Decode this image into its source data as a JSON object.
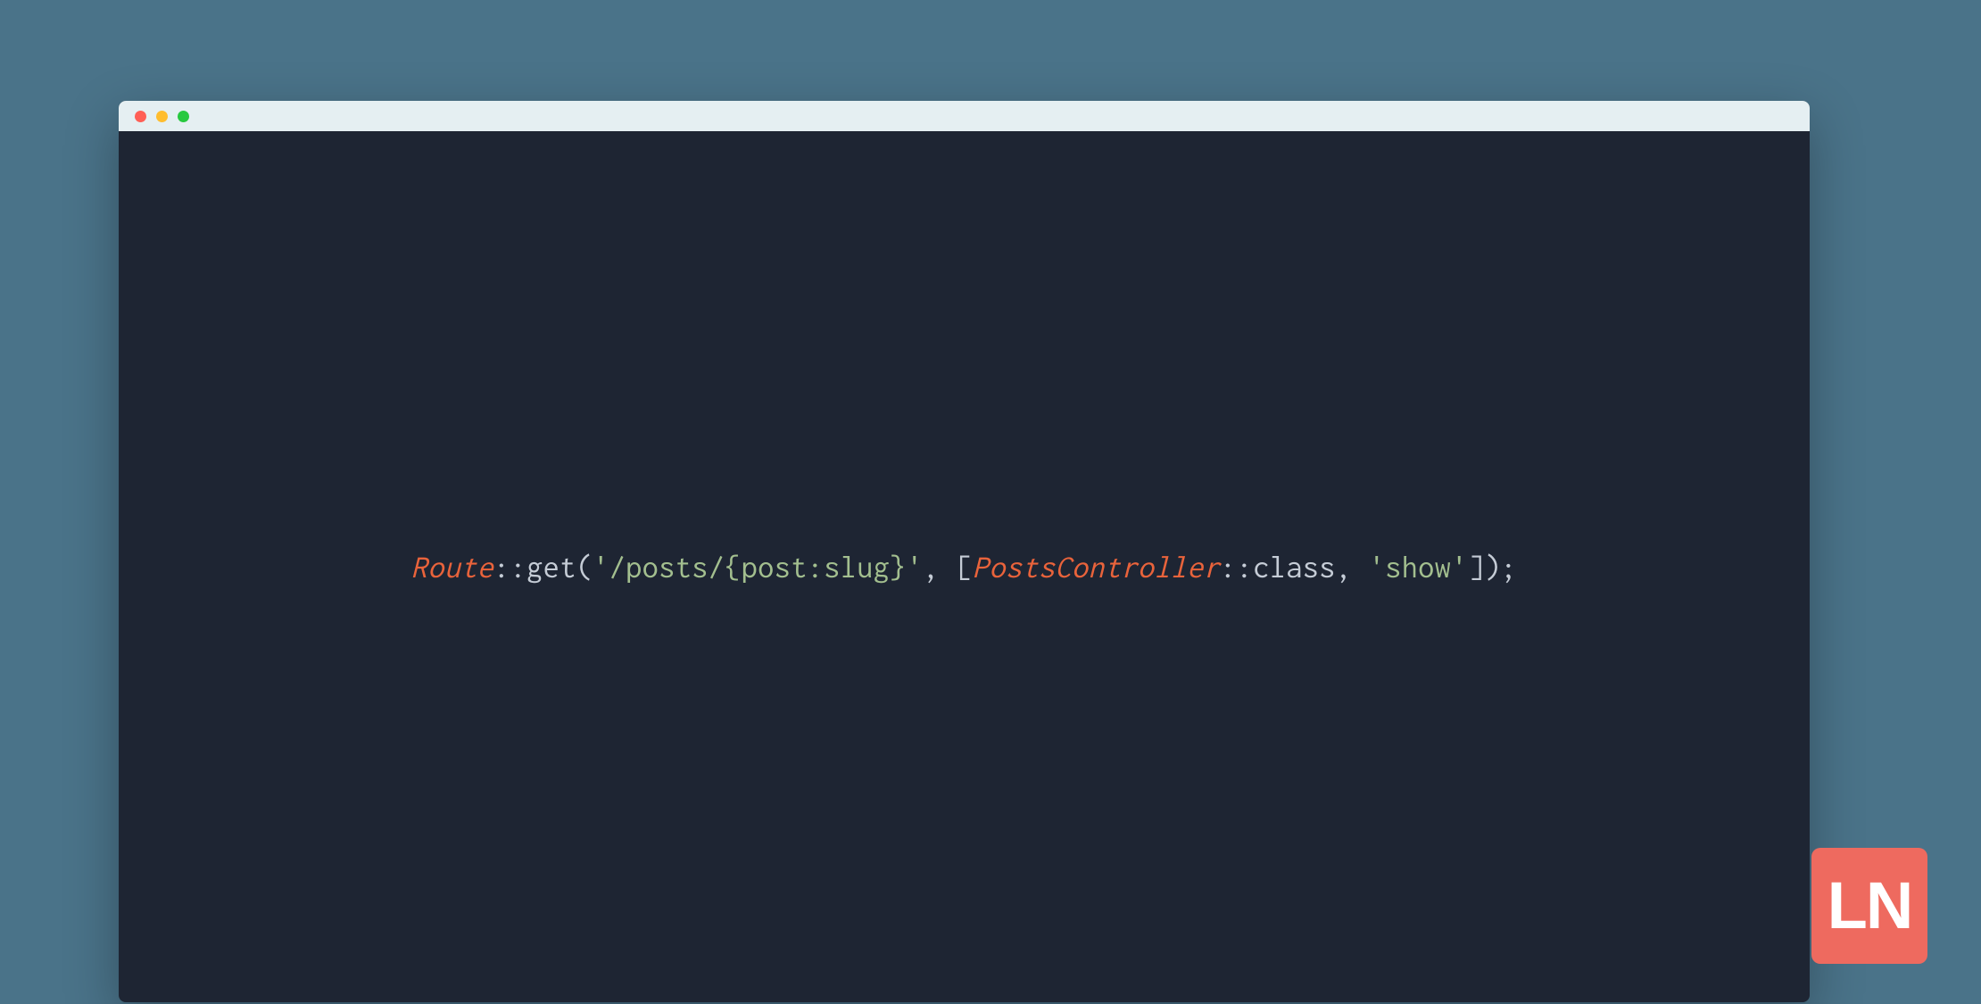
{
  "colors": {
    "background": "#4a7389",
    "editor_bg": "#1e2533",
    "titlebar_bg": "#e5eff2",
    "traffic_red": "#ff5f56",
    "traffic_yellow": "#ffbd2e",
    "traffic_green": "#27c93f",
    "class_token": "#e9633b",
    "default_token": "#c5ccd6",
    "string_token": "#a3bf8f",
    "logo_bg": "#ee6a5f"
  },
  "code": {
    "tokens": [
      {
        "text": "Route",
        "class": "tok-class"
      },
      {
        "text": "::get(",
        "class": "tok-default"
      },
      {
        "text": "'/posts/{post:slug}'",
        "class": "tok-string"
      },
      {
        "text": ", [",
        "class": "tok-default"
      },
      {
        "text": "PostsController",
        "class": "tok-class"
      },
      {
        "text": "::class, ",
        "class": "tok-default"
      },
      {
        "text": "'show'",
        "class": "tok-string"
      },
      {
        "text": "]);",
        "class": "tok-default"
      }
    ]
  },
  "logo": {
    "text": "LN"
  }
}
